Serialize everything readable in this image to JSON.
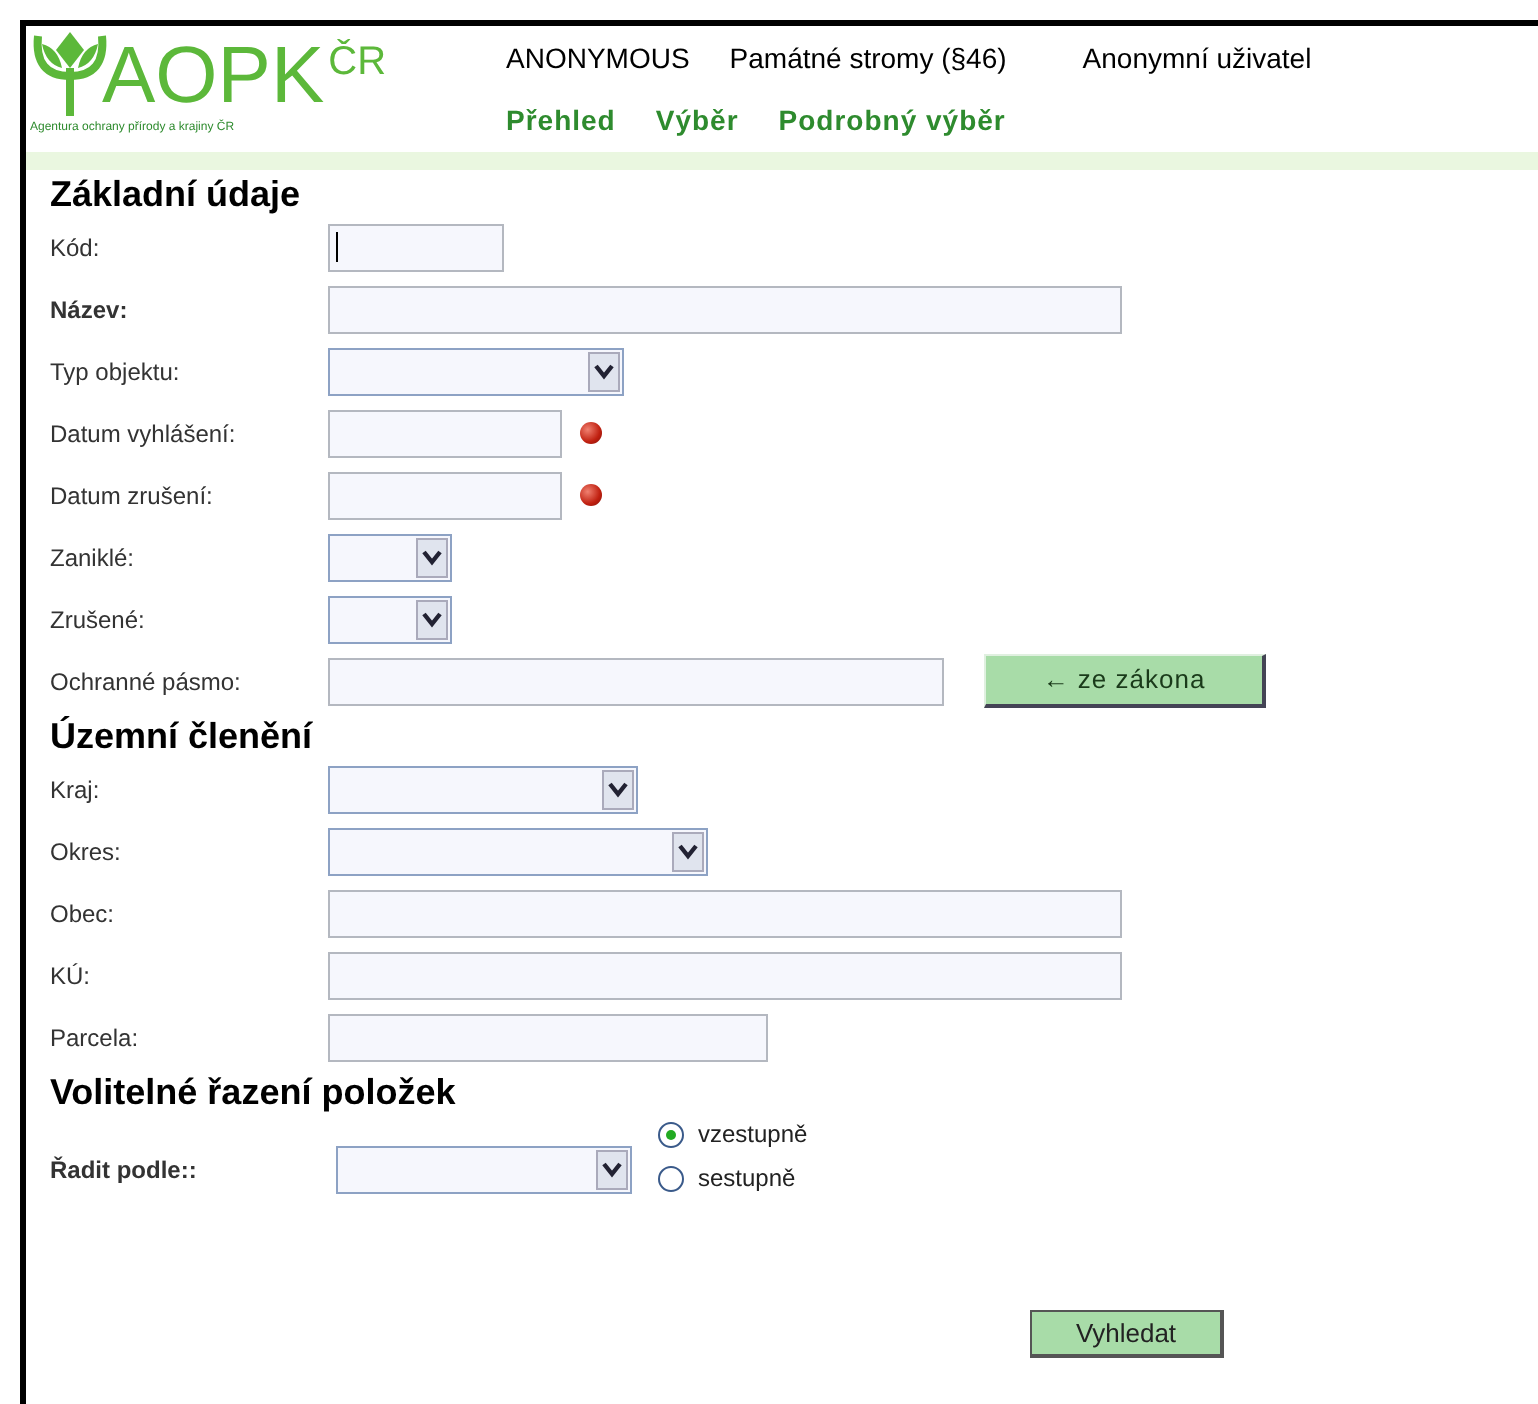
{
  "header": {
    "logo": {
      "text": "AOPK",
      "superscript": "ČR",
      "tagline": "Agentura ochrany přírody a krajiny ČR"
    },
    "user": "ANONYMOUS",
    "module": "Památné stromy (§46)",
    "account": "Anonymní uživatel",
    "nav": [
      {
        "label": "Přehled"
      },
      {
        "label": "Výběr"
      },
      {
        "label": "Podrobný výběr"
      }
    ]
  },
  "sections": [
    {
      "title": "Základní údaje",
      "rows": [
        {
          "label": "Kód:",
          "kind": "text",
          "focused": true
        },
        {
          "label": "Název:",
          "kind": "text",
          "bold": true
        },
        {
          "label": "Typ objektu:",
          "kind": "select"
        },
        {
          "label": "Datum vyhlášení:",
          "kind": "date"
        },
        {
          "label": "Datum zrušení:",
          "kind": "date"
        },
        {
          "label": "Zaniklé:",
          "kind": "select"
        },
        {
          "label": "Zrušené:",
          "kind": "select"
        },
        {
          "label": "Ochranné pásmo:",
          "kind": "text",
          "button": "← ze zákona"
        }
      ]
    },
    {
      "title": "Územní členění",
      "rows": [
        {
          "label": "Kraj:",
          "kind": "select"
        },
        {
          "label": "Okres:",
          "kind": "select"
        },
        {
          "label": "Obec:",
          "kind": "text"
        },
        {
          "label": "KÚ:",
          "kind": "text"
        },
        {
          "label": "Parcela:",
          "kind": "text"
        }
      ]
    },
    {
      "title": "Volitelné řazení položek",
      "rows": [
        {
          "label": "Řadit podle::",
          "kind": "sort",
          "bold": true,
          "options": [
            {
              "label": "vzestupně",
              "selected": true
            },
            {
              "label": "sestupně",
              "selected": false
            }
          ]
        }
      ]
    }
  ],
  "submit": "Vyhledat"
}
